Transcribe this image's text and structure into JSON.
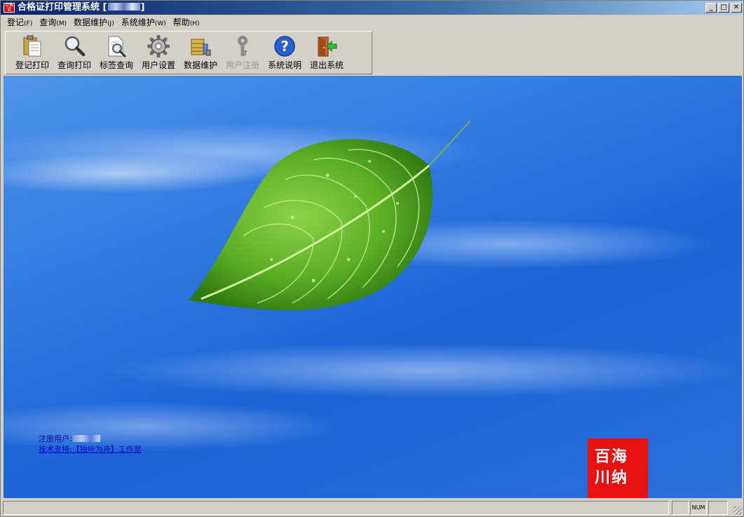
{
  "window": {
    "title": "合格证打印管理系统 [",
    "title_suffix": "]",
    "app_icon_text": "合格证",
    "controls": {
      "minimize": "_",
      "maximize": "□",
      "close": "✕"
    }
  },
  "menu": [
    {
      "label": "登记",
      "accel": "(F)"
    },
    {
      "label": "查询",
      "accel": "(M)"
    },
    {
      "label": "数据维护",
      "accel": "(J)"
    },
    {
      "label": "系统维护",
      "accel": "(W)"
    },
    {
      "label": "帮助",
      "accel": "(H)"
    }
  ],
  "toolbar": [
    {
      "label": "登记打印",
      "icon": "clipboard-icon",
      "enabled": true
    },
    {
      "label": "查询打印",
      "icon": "magnifier-icon",
      "enabled": true
    },
    {
      "label": "标签查询",
      "icon": "document-search-icon",
      "enabled": true
    },
    {
      "label": "用户设置",
      "icon": "gear-icon",
      "enabled": true
    },
    {
      "label": "数据维护",
      "icon": "database-icon",
      "enabled": true
    },
    {
      "label": "用户注册",
      "icon": "key-icon",
      "enabled": false
    },
    {
      "label": "系统说明",
      "icon": "help-icon",
      "enabled": true
    },
    {
      "label": "退出系统",
      "icon": "exit-icon",
      "enabled": true
    }
  ],
  "main": {
    "registered_user_label": "注册用户:",
    "tech_support": "技术支持:【独叶为舟】工作室",
    "seal_line1": "百海",
    "seal_line2": "川纳"
  },
  "statusbar": {
    "num_label": "NUM"
  },
  "colors": {
    "title_start": "#0a246a",
    "background_blue": "#2f78e0",
    "seal_red": "#e81010",
    "link_blue": "#0a0ac8"
  }
}
